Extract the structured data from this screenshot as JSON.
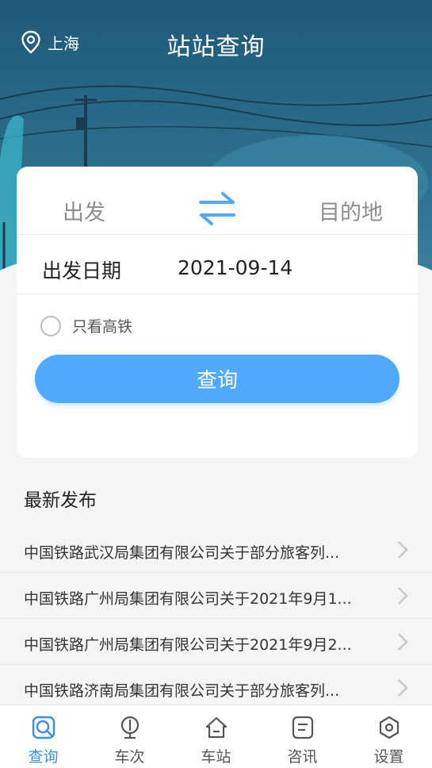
{
  "header": {
    "location_icon": "location-pin-icon",
    "city": "上海",
    "title": "站站查询"
  },
  "search_card": {
    "from_placeholder": "出发",
    "swap_icon": "swap-arrows-icon",
    "to_placeholder": "目的地",
    "date_label": "出发日期",
    "date_value": "2021-09-14",
    "high_speed_only_label": "只看高铁",
    "high_speed_only_checked": false,
    "query_button_label": "查询"
  },
  "news": {
    "title": "最新发布",
    "items": [
      {
        "text": "中国铁路武汉局集团有限公司关于部分旅客列..."
      },
      {
        "text": "中国铁路广州局集团有限公司关于2021年9月1..."
      },
      {
        "text": "中国铁路广州局集团有限公司关于2021年9月2..."
      },
      {
        "text": "中国铁路济南局集团有限公司关于部分旅客列..."
      }
    ]
  },
  "tabbar": {
    "tabs": [
      {
        "label": "查询",
        "icon": "search-icon",
        "active": true
      },
      {
        "label": "车次",
        "icon": "train-icon",
        "active": false
      },
      {
        "label": "车站",
        "icon": "home-icon",
        "active": false
      },
      {
        "label": "咨讯",
        "icon": "document-icon",
        "active": false
      },
      {
        "label": "设置",
        "icon": "settings-icon",
        "active": false
      }
    ]
  },
  "colors": {
    "accent": "#4ea9ff",
    "tab_active": "#3a8fe6",
    "header_bg": "#1f5a78"
  }
}
